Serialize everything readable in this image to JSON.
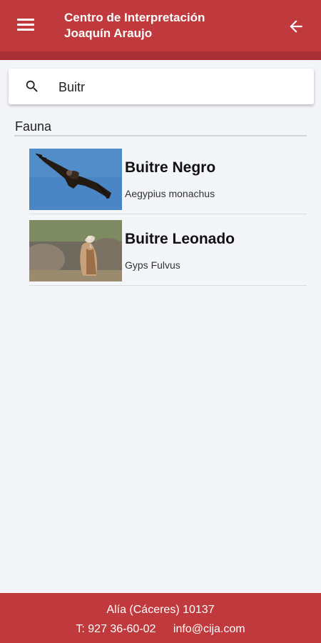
{
  "header": {
    "title": "Centro de Interpretación\nJoaquín Araujo",
    "menu_icon": "menu-icon",
    "back_icon": "arrow-back-icon",
    "color": "#c0393c"
  },
  "search": {
    "value": "Buitr",
    "icon": "search-icon"
  },
  "section": {
    "title": "Fauna"
  },
  "results": [
    {
      "name": "Buitre Negro",
      "scientific": "Aegypius monachus",
      "image": "black-vulture-photo"
    },
    {
      "name": "Buitre Leonado",
      "scientific": "Gyps Fulvus",
      "image": "griffon-vulture-photo"
    }
  ],
  "footer": {
    "address": "Alía (Cáceres)  10137",
    "phone": "T: 927 36-60-02",
    "email": "info@cija.com"
  }
}
